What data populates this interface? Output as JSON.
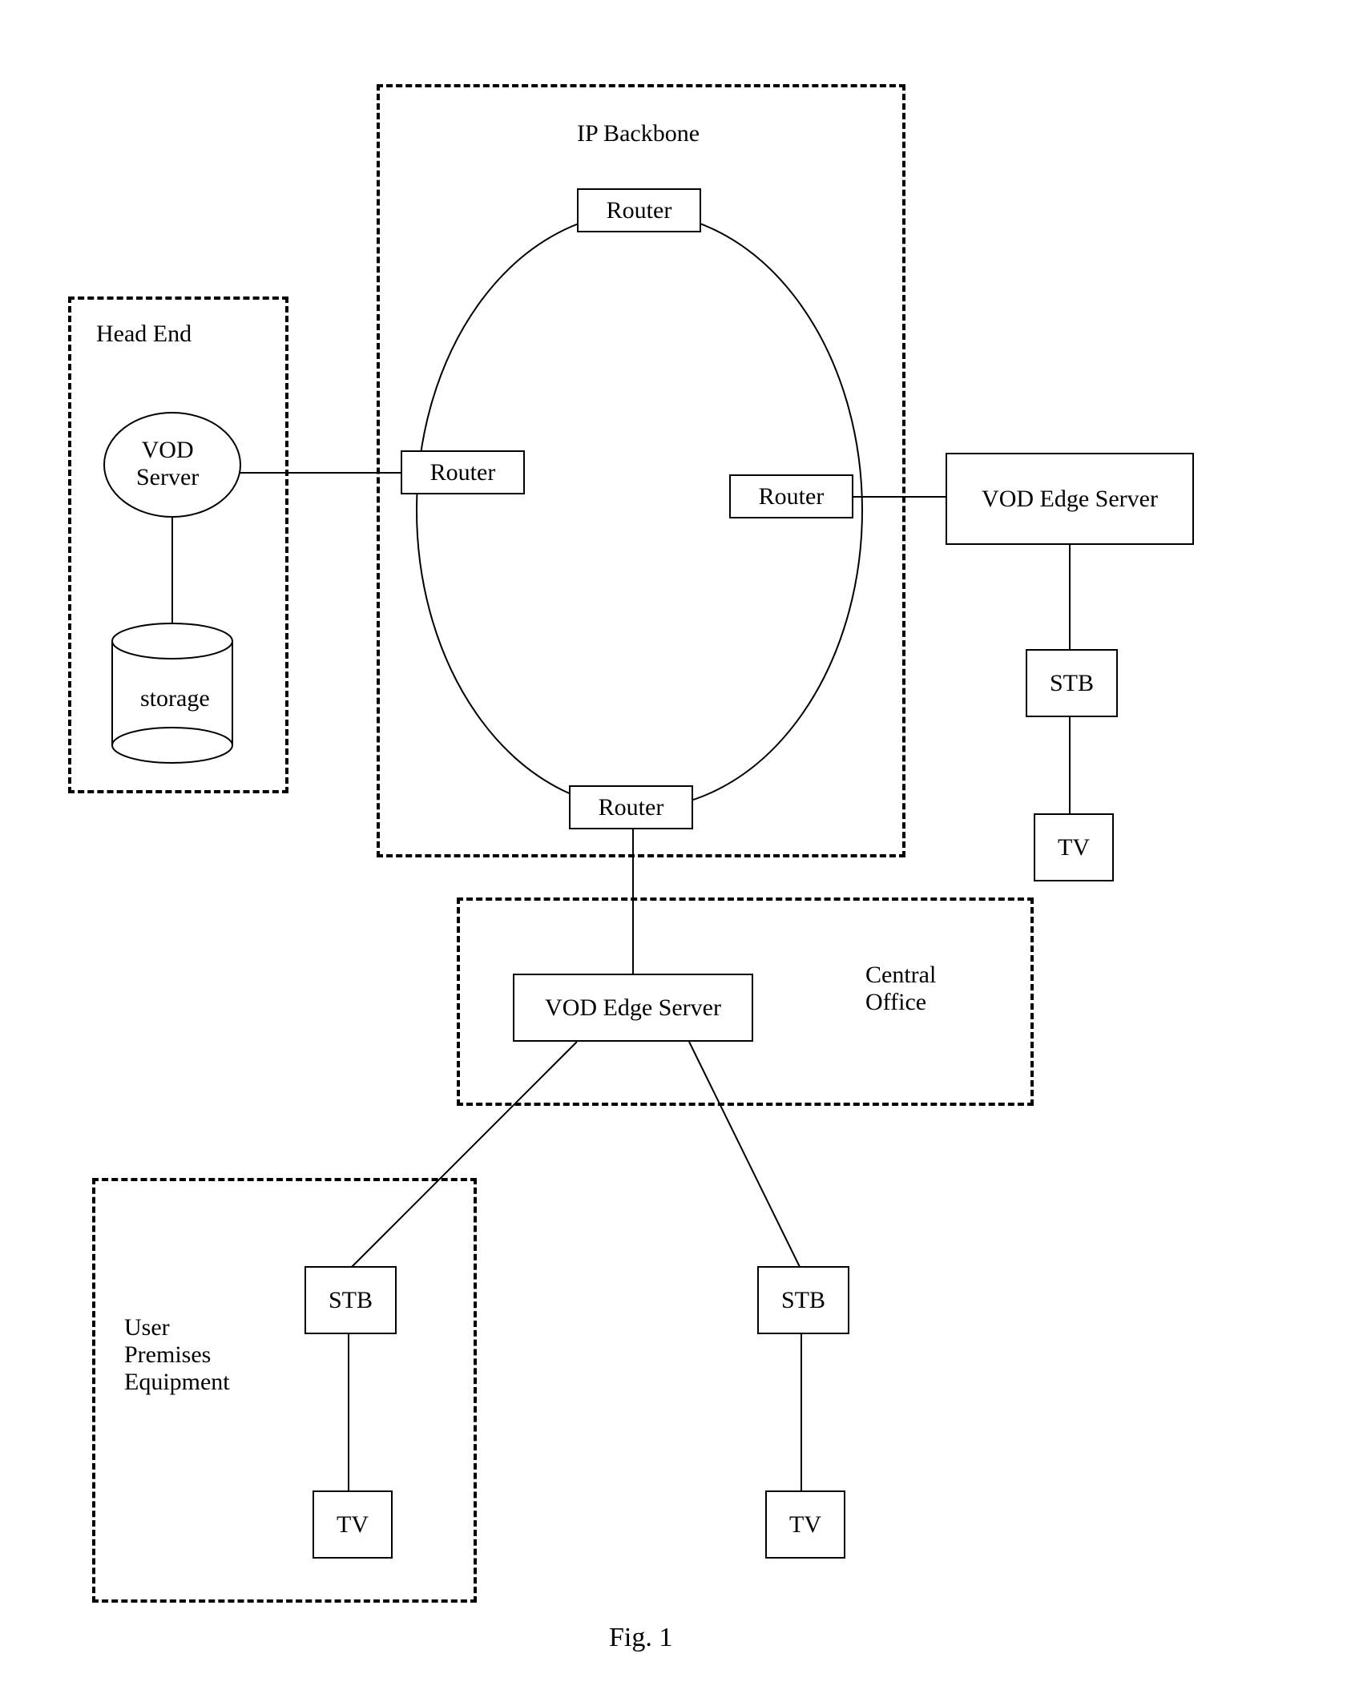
{
  "caption": "Fig. 1",
  "groups": {
    "head_end": {
      "label": "Head End"
    },
    "ip_backbone": {
      "label": "IP Backbone"
    },
    "central_office": {
      "label": "Central\nOffice"
    },
    "user_premises": {
      "label": "User\nPremises\nEquipment"
    }
  },
  "nodes": {
    "vod_server": {
      "label": "VOD\nServer"
    },
    "storage": {
      "label": "storage"
    },
    "router_top": {
      "label": "Router"
    },
    "router_left": {
      "label": "Router"
    },
    "router_right": {
      "label": "Router"
    },
    "router_bottom": {
      "label": "Router"
    },
    "vod_edge_right": {
      "label": "VOD Edge Server"
    },
    "stb_right": {
      "label": "STB"
    },
    "tv_right": {
      "label": "TV"
    },
    "vod_edge_center": {
      "label": "VOD Edge Server"
    },
    "stb_left": {
      "label": "STB"
    },
    "tv_left": {
      "label": "TV"
    },
    "stb_center": {
      "label": "STB"
    },
    "tv_center": {
      "label": "TV"
    }
  }
}
